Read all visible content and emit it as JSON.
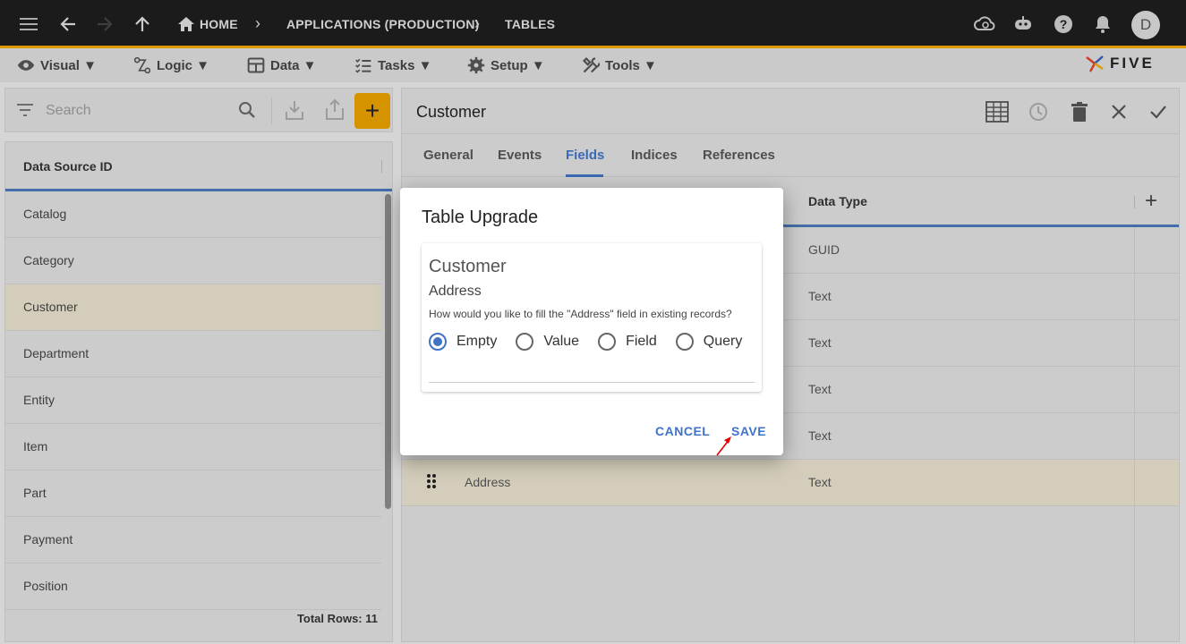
{
  "topbar": {
    "breadcrumbs": [
      "HOME",
      "APPLICATIONS (PRODUCTION)",
      "TABLES"
    ],
    "avatar_initial": "D"
  },
  "menubar": {
    "items": [
      {
        "label": "Visual ▼",
        "icon": "eye-icon"
      },
      {
        "label": "Logic ▼",
        "icon": "logic-icon"
      },
      {
        "label": "Data ▼",
        "icon": "table-icon"
      },
      {
        "label": "Tasks ▼",
        "icon": "tasks-icon"
      },
      {
        "label": "Setup ▼",
        "icon": "gear-icon"
      },
      {
        "label": "Tools ▼",
        "icon": "tools-icon"
      }
    ],
    "brand": "FIVE"
  },
  "left_panel": {
    "search_placeholder": "Search",
    "column_header": "Data Source ID",
    "rows": [
      "Catalog",
      "Category",
      "Customer",
      "Department",
      "Entity",
      "Item",
      "Part",
      "Payment",
      "Position"
    ],
    "selected_row": "Customer",
    "total_rows": "Total Rows: 11"
  },
  "right_panel": {
    "title": "Customer",
    "tabs": [
      "General",
      "Events",
      "Fields",
      "Indices",
      "References"
    ],
    "active_tab": "Fields",
    "column_header": "Data Type",
    "rows": [
      {
        "name": "",
        "type": "GUID"
      },
      {
        "name": "",
        "type": "Text"
      },
      {
        "name": "",
        "type": "Text"
      },
      {
        "name": "",
        "type": "Text"
      },
      {
        "name": "",
        "type": "Text"
      },
      {
        "name": "Address",
        "type": "Text"
      }
    ]
  },
  "modal": {
    "title": "Table Upgrade",
    "entity": "Customer",
    "field": "Address",
    "question": "How would you like to fill the \"Address\" field in existing records?",
    "options": [
      "Empty",
      "Value",
      "Field",
      "Query"
    ],
    "selected_option": "Empty",
    "cancel_label": "CANCEL",
    "save_label": "SAVE"
  },
  "colors": {
    "accent_blue": "#3f73c6",
    "add_button": "#e8a000",
    "topbar": "#1e1e1e",
    "annotation_arrow": "#e00000"
  }
}
